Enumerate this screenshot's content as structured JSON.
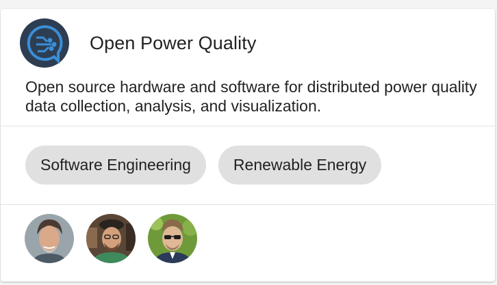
{
  "project": {
    "title": "Open Power Quality",
    "description": "Open source hardware and software for distributed power quality data collection, analysis, and visualization.",
    "logo_icon": "opq-circuit-logo-icon",
    "logo_colors": {
      "background": "#2e3e52",
      "circuit": "#3a8fd9"
    }
  },
  "interests": [
    {
      "label": "Software Engineering"
    },
    {
      "label": "Renewable Energy"
    }
  ],
  "participants": [
    {
      "icon": "participant-avatar-1",
      "background": "#9aa4ab"
    },
    {
      "icon": "participant-avatar-2",
      "background": "#5a4636"
    },
    {
      "icon": "participant-avatar-3",
      "background": "#6f9a3a"
    }
  ]
}
